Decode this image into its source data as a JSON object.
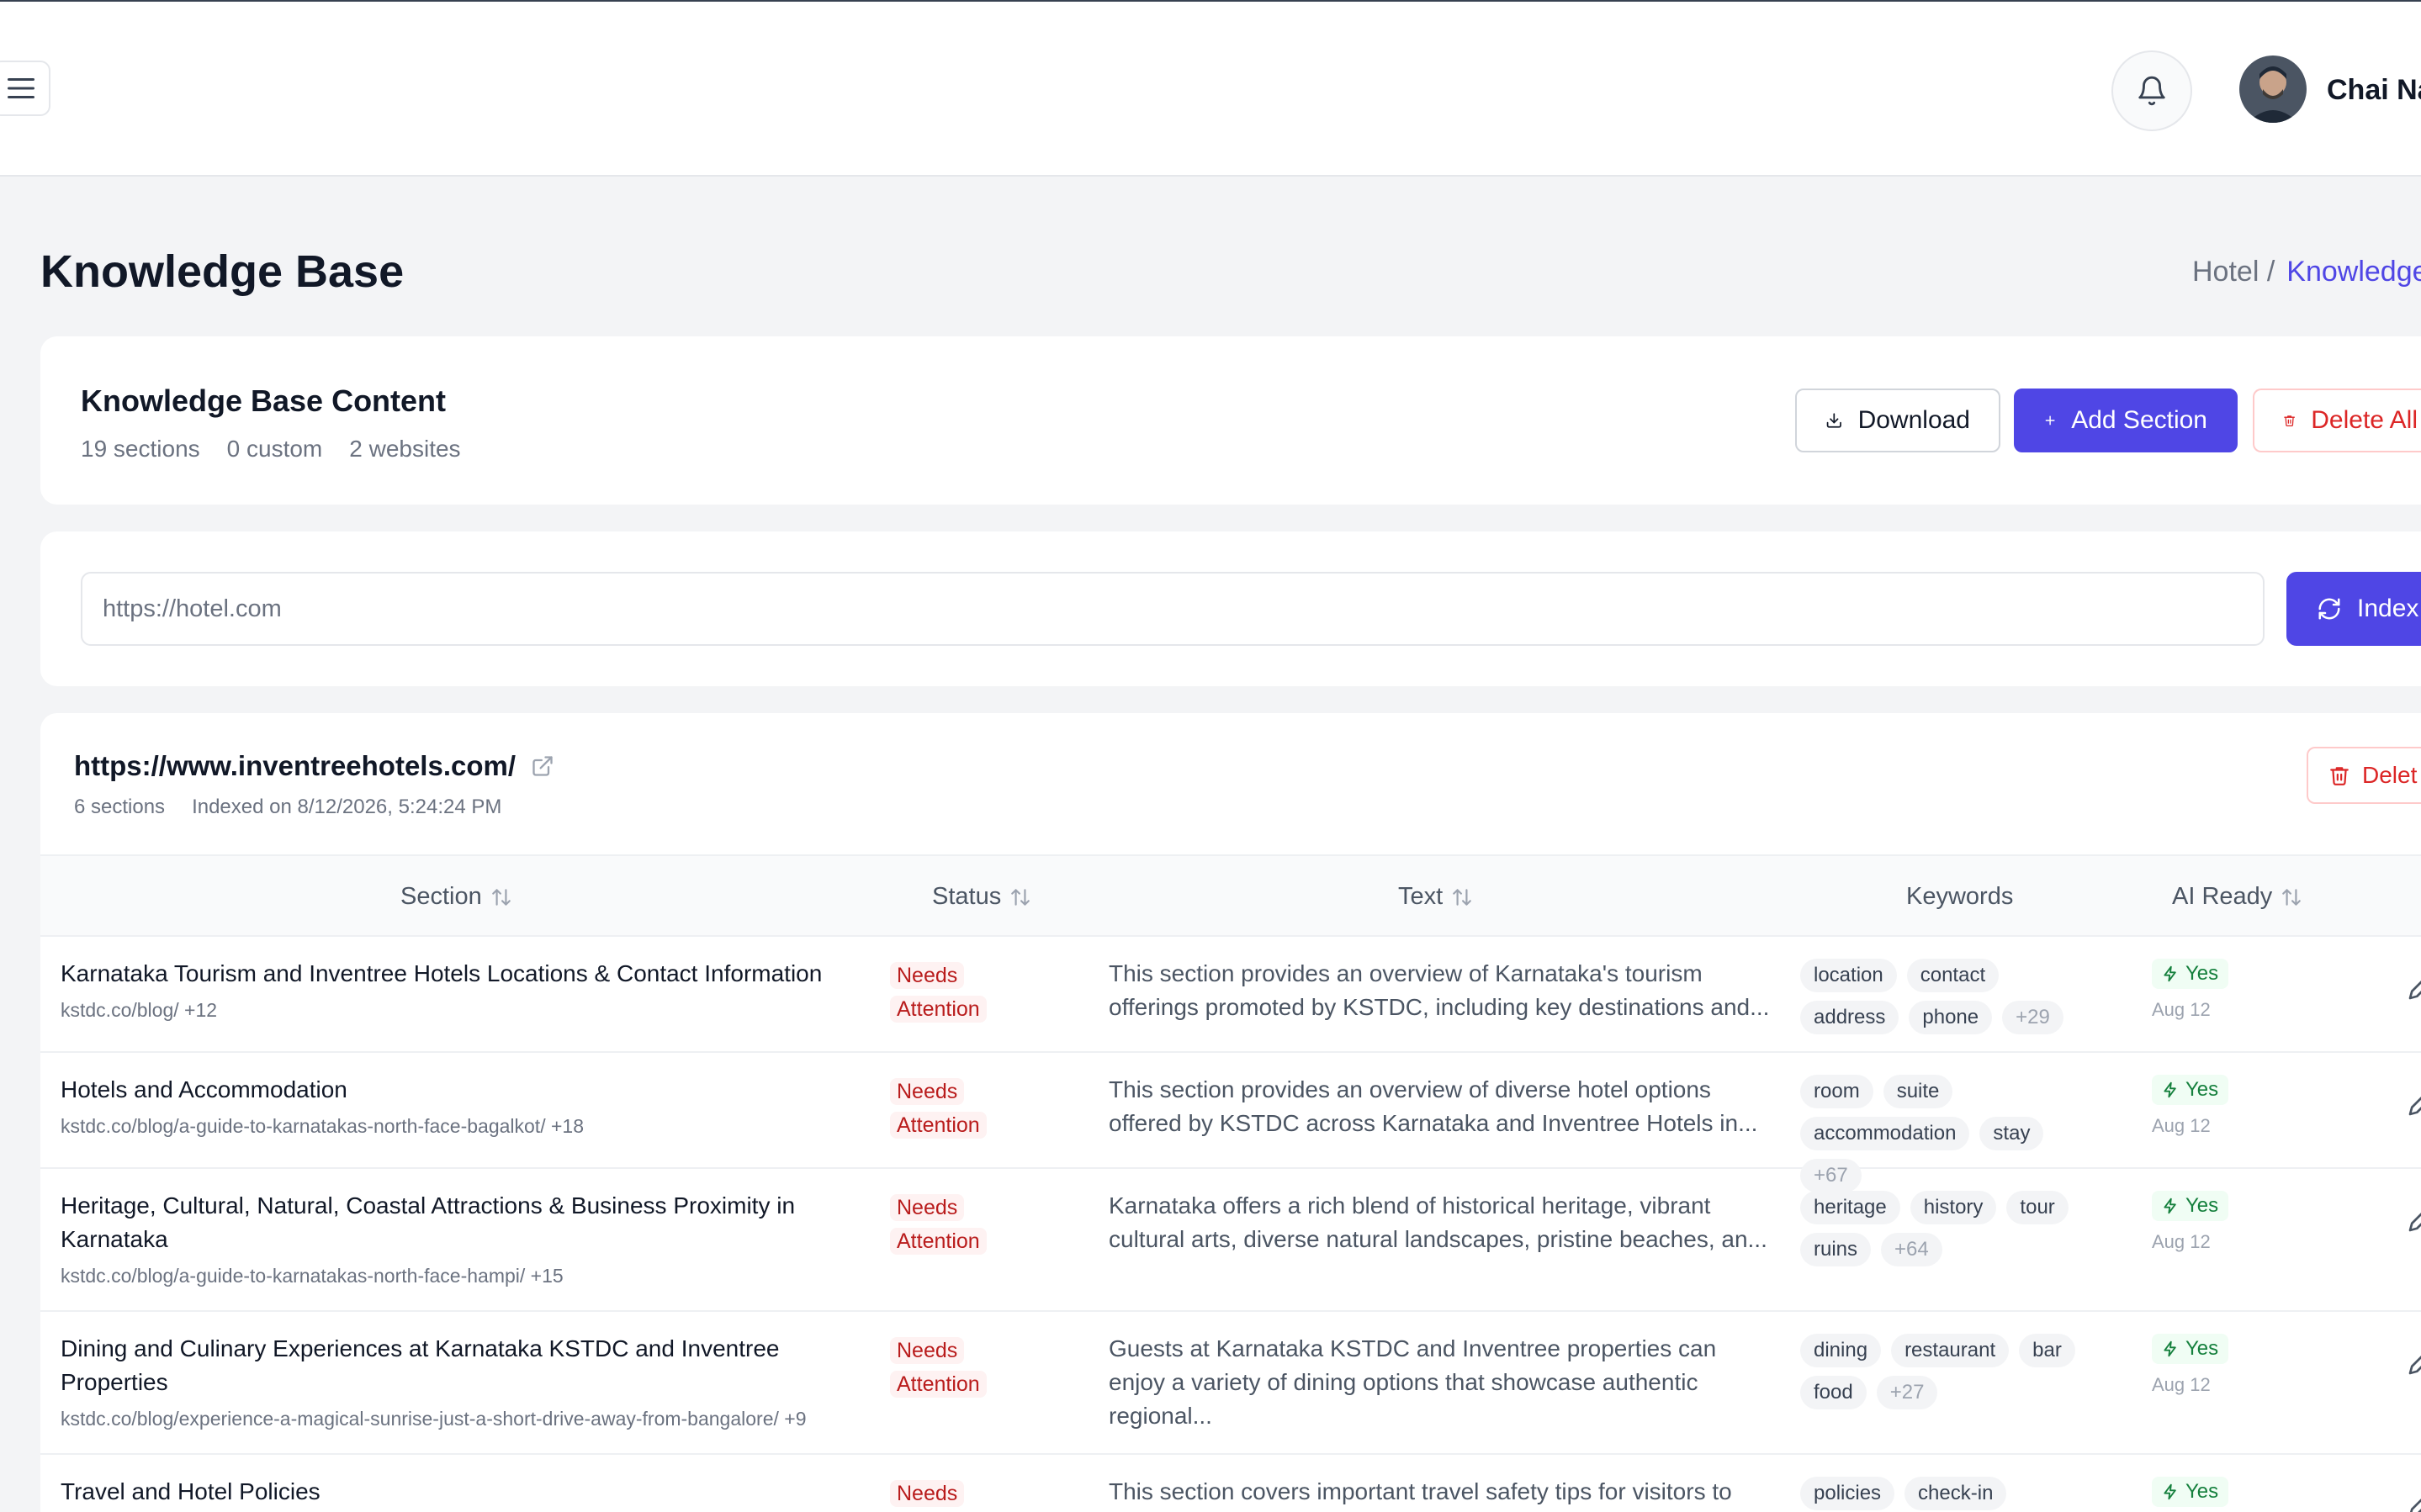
{
  "user": {
    "name": "Chai Na"
  },
  "page": {
    "title": "Knowledge Base"
  },
  "breadcrumb": {
    "parent": "Hotel /",
    "current": "Knowledge"
  },
  "kb": {
    "title": "Knowledge Base Content",
    "stats": [
      "19 sections",
      "0 custom",
      "2 websites"
    ],
    "download_label": "Download",
    "add_label": "Add Section",
    "delete_all_label": "Delete All"
  },
  "indexer": {
    "placeholder": "https://hotel.com",
    "index_label": "Index"
  },
  "site": {
    "url": "https://www.inventreehotels.com/",
    "sections": "6 sections",
    "indexed": "Indexed on 8/12/2026, 5:24:24 PM",
    "delete_label": "Delet"
  },
  "table": {
    "headers": {
      "section": "Section",
      "status": "Status",
      "text": "Text",
      "keywords": "Keywords",
      "ai_ready": "AI Ready"
    },
    "rows": [
      {
        "title": "Karnataka Tourism and Inventree Hotels Locations & Contact Information",
        "source": "kstdc.co/blog/ +12",
        "status": [
          "Needs",
          "Attention"
        ],
        "text": "This section provides an overview of Karnataka's tourism offerings promoted by KSTDC, including key destinations and...",
        "keywords": [
          "location",
          "contact",
          "address",
          "phone"
        ],
        "more": "+29",
        "ai": "Yes",
        "date": "Aug 12"
      },
      {
        "title": "Hotels and Accommodation",
        "source": "kstdc.co/blog/a-guide-to-karnatakas-north-face-bagalkot/ +18",
        "status": [
          "Needs",
          "Attention"
        ],
        "text": "This section provides an overview of diverse hotel options offered by KSTDC across Karnataka and Inventree Hotels in...",
        "keywords": [
          "room",
          "suite",
          "accommodation",
          "stay"
        ],
        "more": "+67",
        "ai": "Yes",
        "date": "Aug 12"
      },
      {
        "title": "Heritage, Cultural, Natural, Coastal Attractions & Business Proximity in Karnataka",
        "source": "kstdc.co/blog/a-guide-to-karnatakas-north-face-hampi/ +15",
        "status": [
          "Needs",
          "Attention"
        ],
        "text": "Karnataka offers a rich blend of historical heritage, vibrant cultural arts, diverse natural landscapes, pristine beaches, an...",
        "keywords": [
          "heritage",
          "history",
          "tour",
          "ruins"
        ],
        "more": "+64",
        "ai": "Yes",
        "date": "Aug 12"
      },
      {
        "title": "Dining and Culinary Experiences at Karnataka KSTDC and Inventree Properties",
        "source": "kstdc.co/blog/experience-a-magical-sunrise-just-a-short-drive-away-from-bangalore/ +9",
        "status": [
          "Needs",
          "Attention"
        ],
        "text": "Guests at Karnataka KSTDC and Inventree properties can enjoy a variety of dining options that showcase authentic regional...",
        "keywords": [
          "dining",
          "restaurant",
          "bar",
          "food"
        ],
        "more": "+27",
        "ai": "Yes",
        "date": "Aug 12"
      },
      {
        "title": "Travel and Hotel Policies",
        "source": "",
        "status": [
          "Needs",
          ""
        ],
        "text": "This section covers important travel safety tips for visitors to",
        "keywords": [
          "policies",
          "check-in"
        ],
        "more": "",
        "ai": "Yes",
        "date": ""
      }
    ]
  }
}
